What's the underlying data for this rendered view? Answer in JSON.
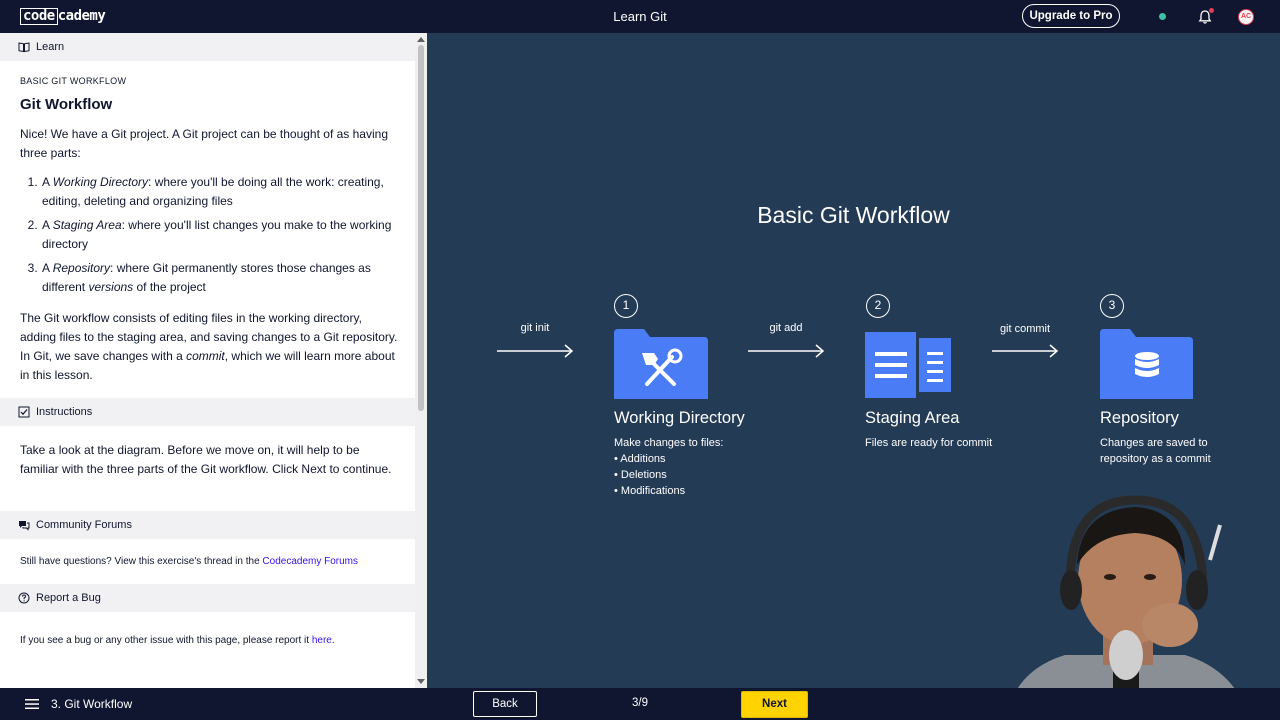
{
  "topbar": {
    "logo_left": "code",
    "logo_right": "cademy",
    "title": "Learn Git",
    "upgrade_label": "Upgrade to Pro",
    "avatar_initials": "AC"
  },
  "lesson": {
    "learn_header": "Learn",
    "kicker": "BASIC GIT WORKFLOW",
    "title": "Git Workflow",
    "intro": "Nice! We have a Git project. A Git project can be thought of as having three parts:",
    "parts": [
      {
        "prefix": "A ",
        "term": "Working Directory",
        "rest": ": where you'll be doing all the work: creating, editing, deleting and organizing files"
      },
      {
        "prefix": "A ",
        "term": "Staging Area",
        "rest": ": where you'll list changes you make to the working directory"
      },
      {
        "prefix": "A ",
        "term": "Repository",
        "rest_a": ": where Git permanently stores those changes as different ",
        "rest_em": "versions",
        "rest_b": " of the project"
      }
    ],
    "summary_a": "The Git workflow consists of editing files in the working directory, adding files to the staging area, and saving changes to a Git repository. In Git, we save changes with a ",
    "summary_em": "commit",
    "summary_b": ", which we will learn more about in this lesson.",
    "instructions_header": "Instructions",
    "instructions_text": "Take a look at the diagram. Before we move on, it will help to be familiar with the three parts of the Git workflow. Click Next to continue.",
    "forums_header": "Community Forums",
    "forums_text": "Still have questions? View this exercise's thread in the ",
    "forums_link": "Codecademy Forums",
    "bug_header": "Report a Bug",
    "bug_text": "If you see a bug or any other issue with this page, please report it ",
    "bug_link": "here",
    "bug_end": "."
  },
  "diagram": {
    "title": "Basic Git Workflow",
    "arrows": [
      "git init",
      "git add",
      "git commit"
    ],
    "steps": [
      {
        "num": "1",
        "title": "Working Directory",
        "desc_lines": [
          "Make changes to files:",
          "• Additions",
          "• Deletions",
          "• Modifications"
        ],
        "icon": "tools-folder-icon"
      },
      {
        "num": "2",
        "title": "Staging Area",
        "desc_lines": [
          "Files are ready for commit"
        ],
        "icon": "documents-icon"
      },
      {
        "num": "3",
        "title": "Repository",
        "desc_lines": [
          "Changes are saved to",
          "repository as a commit"
        ],
        "icon": "database-folder-icon"
      }
    ],
    "colors": {
      "background": "#243b55",
      "icon_blue": "#4a7cf5"
    }
  },
  "bottombar": {
    "exercise_name": "3. Git Workflow",
    "back_label": "Back",
    "progress": "3/9",
    "next_label": "Next"
  }
}
